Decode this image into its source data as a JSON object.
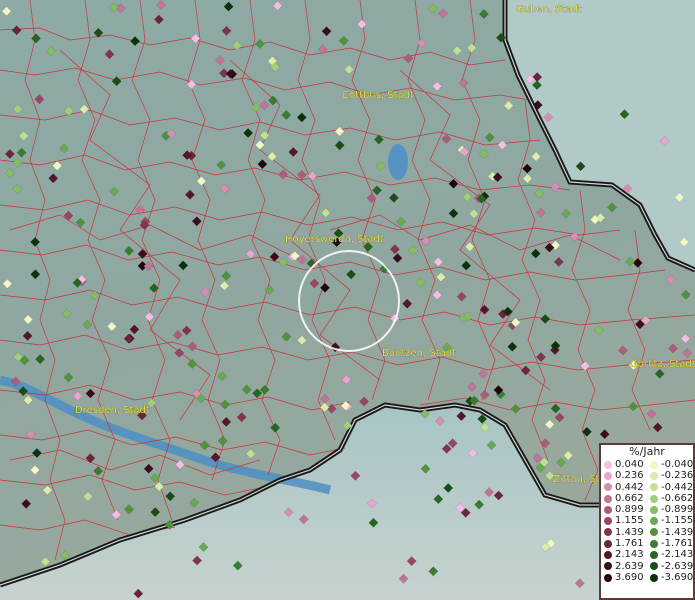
{
  "map": {
    "cities": [
      {
        "name": "Guben, Stadt"
      },
      {
        "name": "Cottbus, Stadt"
      },
      {
        "name": "Hoyerswerda, Stadt"
      },
      {
        "name": "Bautzen, Stadt"
      },
      {
        "name": "Görlitz, Stadt"
      },
      {
        "name": "Dresden, Stadt"
      },
      {
        "name": "Zittau, St..."
      }
    ]
  },
  "legend": {
    "title": "%/Jahr",
    "positive": [
      {
        "label": "0.040",
        "color": "#f4bde6"
      },
      {
        "label": "0.236",
        "color": "#e8a6cf"
      },
      {
        "label": "0.442",
        "color": "#d68fb4"
      },
      {
        "label": "0.662",
        "color": "#c17496"
      },
      {
        "label": "0.899",
        "color": "#ad5c7d"
      },
      {
        "label": "1.155",
        "color": "#984664"
      },
      {
        "label": "1.439",
        "color": "#82334f"
      },
      {
        "label": "1.761",
        "color": "#6c233c"
      },
      {
        "label": "2.143",
        "color": "#55162b"
      },
      {
        "label": "2.639",
        "color": "#3c0c1c"
      },
      {
        "label": "3.690",
        "color": "#22040e"
      }
    ],
    "negative": [
      {
        "label": "-0.040",
        "color": "#f1f6c4"
      },
      {
        "label": "-0.236",
        "color": "#dcecac"
      },
      {
        "label": "-0.442",
        "color": "#c2df92"
      },
      {
        "label": "-0.662",
        "color": "#a4cf7a"
      },
      {
        "label": "-0.899",
        "color": "#85bd65"
      },
      {
        "label": "-1.155",
        "color": "#68a951"
      },
      {
        "label": "-1.439",
        "color": "#4f933f"
      },
      {
        "label": "-1.761",
        "color": "#3a7c30"
      },
      {
        "label": "-2.143",
        "color": "#286522"
      },
      {
        "label": "-2.639",
        "color": "#194d16"
      },
      {
        "label": "-3.690",
        "color": "#0b320b"
      }
    ]
  }
}
